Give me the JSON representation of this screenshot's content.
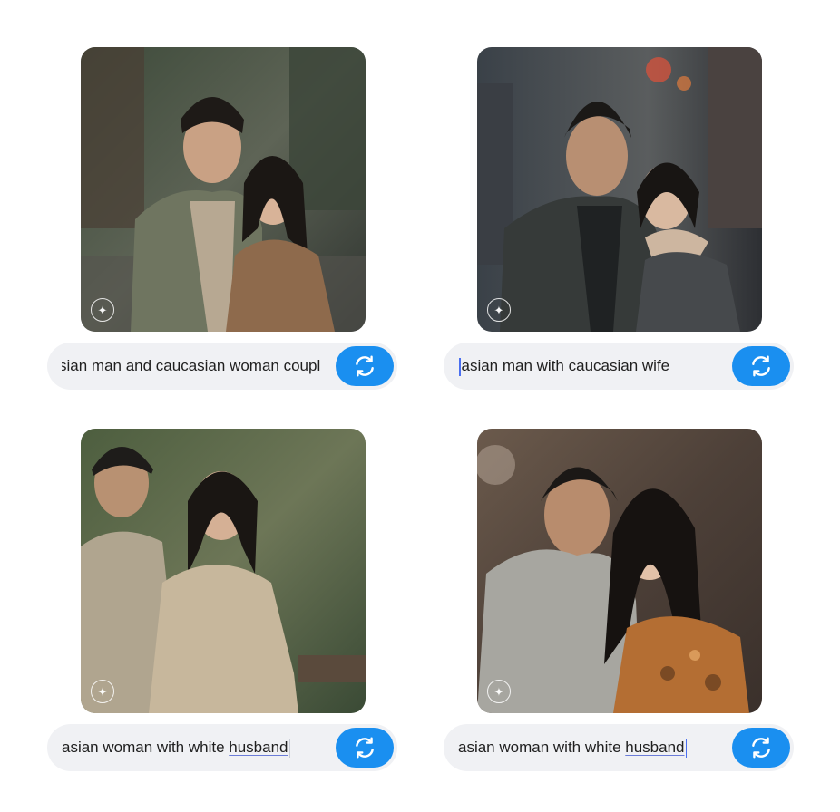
{
  "cards": [
    {
      "prompt_text": "sian man and caucasian woman coupl",
      "prompt_underlined": "",
      "regenerate_icon": "refresh-icon",
      "badge_icon": "sparkle-icon"
    },
    {
      "prompt_text": "asian man with caucasian wife",
      "prompt_underlined": "",
      "regenerate_icon": "refresh-icon",
      "badge_icon": "sparkle-icon"
    },
    {
      "prompt_text": "asian woman with white ",
      "prompt_underlined": "husband",
      "regenerate_icon": "refresh-icon",
      "badge_icon": "sparkle-icon"
    },
    {
      "prompt_text": "asian woman with white ",
      "prompt_underlined": "husband",
      "regenerate_icon": "refresh-icon",
      "badge_icon": "sparkle-icon"
    }
  ],
  "colors": {
    "button_blue": "#1a8ff0",
    "bar_background": "#f0f1f4",
    "caret": "#4a6ff0",
    "spell_underline": "#6b7cd8"
  }
}
